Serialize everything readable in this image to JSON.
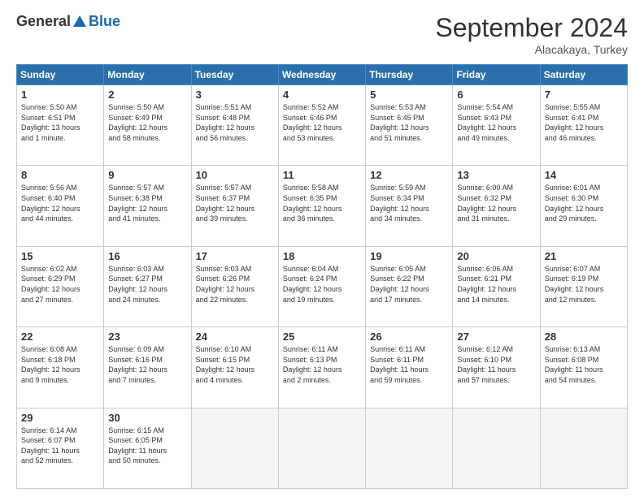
{
  "header": {
    "logo": {
      "general": "General",
      "blue": "Blue"
    },
    "title": "September 2024",
    "location": "Alacakaya, Turkey"
  },
  "weekdays": [
    "Sunday",
    "Monday",
    "Tuesday",
    "Wednesday",
    "Thursday",
    "Friday",
    "Saturday"
  ],
  "weeks": [
    [
      {
        "day": "1",
        "info": "Sunrise: 5:50 AM\nSunset: 6:51 PM\nDaylight: 13 hours\nand 1 minute."
      },
      {
        "day": "2",
        "info": "Sunrise: 5:50 AM\nSunset: 6:49 PM\nDaylight: 12 hours\nand 58 minutes."
      },
      {
        "day": "3",
        "info": "Sunrise: 5:51 AM\nSunset: 6:48 PM\nDaylight: 12 hours\nand 56 minutes."
      },
      {
        "day": "4",
        "info": "Sunrise: 5:52 AM\nSunset: 6:46 PM\nDaylight: 12 hours\nand 53 minutes."
      },
      {
        "day": "5",
        "info": "Sunrise: 5:53 AM\nSunset: 6:45 PM\nDaylight: 12 hours\nand 51 minutes."
      },
      {
        "day": "6",
        "info": "Sunrise: 5:54 AM\nSunset: 6:43 PM\nDaylight: 12 hours\nand 49 minutes."
      },
      {
        "day": "7",
        "info": "Sunrise: 5:55 AM\nSunset: 6:41 PM\nDaylight: 12 hours\nand 46 minutes."
      }
    ],
    [
      {
        "day": "8",
        "info": "Sunrise: 5:56 AM\nSunset: 6:40 PM\nDaylight: 12 hours\nand 44 minutes."
      },
      {
        "day": "9",
        "info": "Sunrise: 5:57 AM\nSunset: 6:38 PM\nDaylight: 12 hours\nand 41 minutes."
      },
      {
        "day": "10",
        "info": "Sunrise: 5:57 AM\nSunset: 6:37 PM\nDaylight: 12 hours\nand 39 minutes."
      },
      {
        "day": "11",
        "info": "Sunrise: 5:58 AM\nSunset: 6:35 PM\nDaylight: 12 hours\nand 36 minutes."
      },
      {
        "day": "12",
        "info": "Sunrise: 5:59 AM\nSunset: 6:34 PM\nDaylight: 12 hours\nand 34 minutes."
      },
      {
        "day": "13",
        "info": "Sunrise: 6:00 AM\nSunset: 6:32 PM\nDaylight: 12 hours\nand 31 minutes."
      },
      {
        "day": "14",
        "info": "Sunrise: 6:01 AM\nSunset: 6:30 PM\nDaylight: 12 hours\nand 29 minutes."
      }
    ],
    [
      {
        "day": "15",
        "info": "Sunrise: 6:02 AM\nSunset: 6:29 PM\nDaylight: 12 hours\nand 27 minutes."
      },
      {
        "day": "16",
        "info": "Sunrise: 6:03 AM\nSunset: 6:27 PM\nDaylight: 12 hours\nand 24 minutes."
      },
      {
        "day": "17",
        "info": "Sunrise: 6:03 AM\nSunset: 6:26 PM\nDaylight: 12 hours\nand 22 minutes."
      },
      {
        "day": "18",
        "info": "Sunrise: 6:04 AM\nSunset: 6:24 PM\nDaylight: 12 hours\nand 19 minutes."
      },
      {
        "day": "19",
        "info": "Sunrise: 6:05 AM\nSunset: 6:22 PM\nDaylight: 12 hours\nand 17 minutes."
      },
      {
        "day": "20",
        "info": "Sunrise: 6:06 AM\nSunset: 6:21 PM\nDaylight: 12 hours\nand 14 minutes."
      },
      {
        "day": "21",
        "info": "Sunrise: 6:07 AM\nSunset: 6:19 PM\nDaylight: 12 hours\nand 12 minutes."
      }
    ],
    [
      {
        "day": "22",
        "info": "Sunrise: 6:08 AM\nSunset: 6:18 PM\nDaylight: 12 hours\nand 9 minutes."
      },
      {
        "day": "23",
        "info": "Sunrise: 6:09 AM\nSunset: 6:16 PM\nDaylight: 12 hours\nand 7 minutes."
      },
      {
        "day": "24",
        "info": "Sunrise: 6:10 AM\nSunset: 6:15 PM\nDaylight: 12 hours\nand 4 minutes."
      },
      {
        "day": "25",
        "info": "Sunrise: 6:11 AM\nSunset: 6:13 PM\nDaylight: 12 hours\nand 2 minutes."
      },
      {
        "day": "26",
        "info": "Sunrise: 6:11 AM\nSunset: 6:11 PM\nDaylight: 11 hours\nand 59 minutes."
      },
      {
        "day": "27",
        "info": "Sunrise: 6:12 AM\nSunset: 6:10 PM\nDaylight: 11 hours\nand 57 minutes."
      },
      {
        "day": "28",
        "info": "Sunrise: 6:13 AM\nSunset: 6:08 PM\nDaylight: 11 hours\nand 54 minutes."
      }
    ],
    [
      {
        "day": "29",
        "info": "Sunrise: 6:14 AM\nSunset: 6:07 PM\nDaylight: 11 hours\nand 52 minutes."
      },
      {
        "day": "30",
        "info": "Sunrise: 6:15 AM\nSunset: 6:05 PM\nDaylight: 11 hours\nand 50 minutes."
      },
      {
        "day": "",
        "info": ""
      },
      {
        "day": "",
        "info": ""
      },
      {
        "day": "",
        "info": ""
      },
      {
        "day": "",
        "info": ""
      },
      {
        "day": "",
        "info": ""
      }
    ]
  ]
}
